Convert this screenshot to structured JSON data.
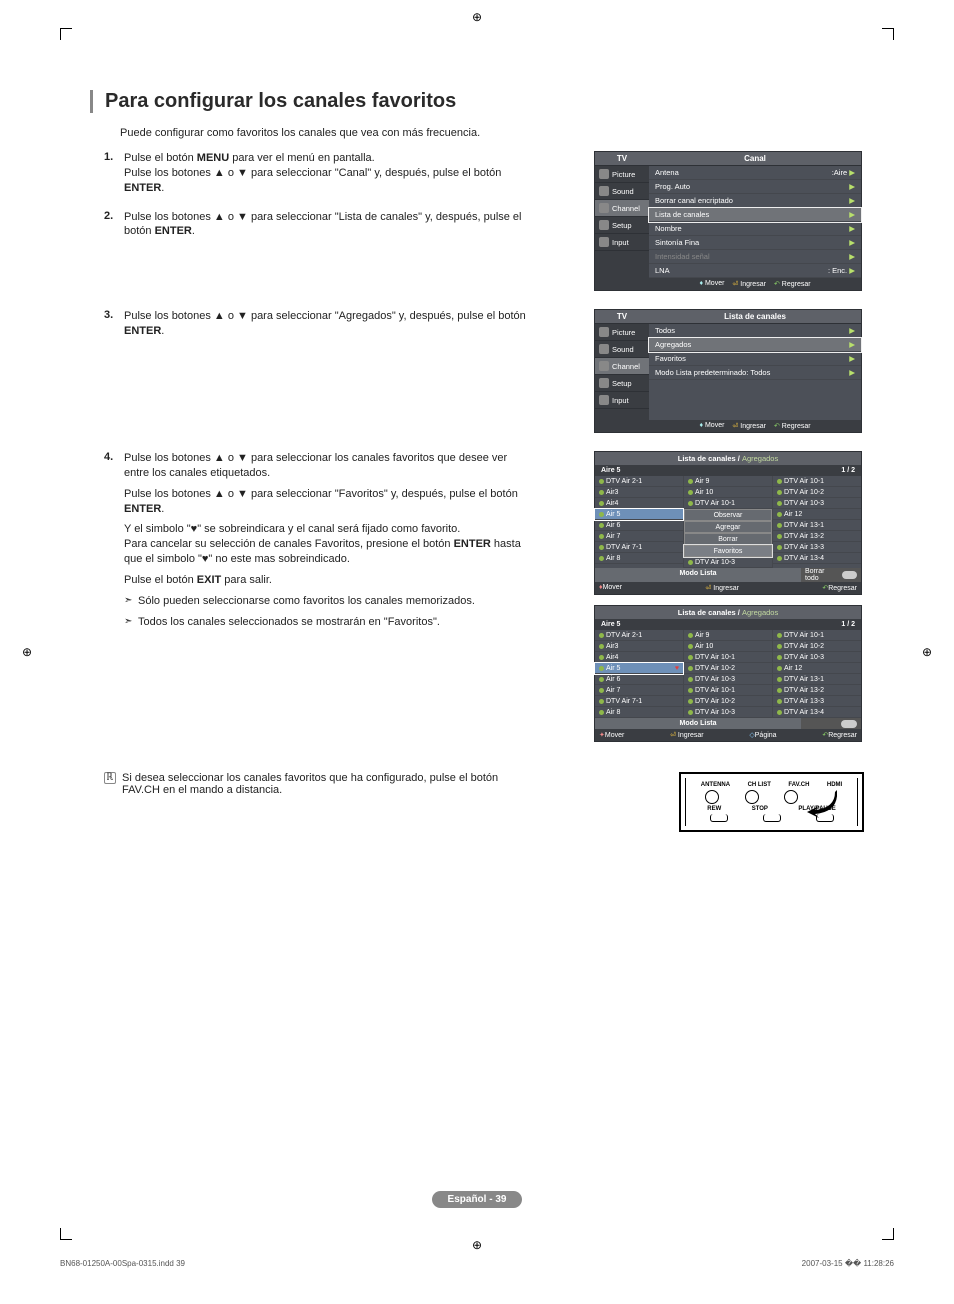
{
  "title": "Para configurar los canales favoritos",
  "intro": "Puede configurar como favoritos los canales que vea con más frecuencia.",
  "steps": {
    "s1": {
      "n": "1.",
      "a": "Pulse el botón ",
      "b": "MENU",
      "c": " para ver el menú en pantalla.",
      "d": "Pulse los botones ▲ o ▼ para seleccionar \"Canal\" y, después, pulse el botón ",
      "e": "ENTER",
      "f": "."
    },
    "s2": {
      "n": "2.",
      "a": "Pulse los botones ▲ o ▼ para seleccionar \"Lista de canales\" y, después, pulse el botón ",
      "b": "ENTER",
      "c": "."
    },
    "s3": {
      "n": "3.",
      "a": "Pulse los botones ▲ o ▼ para seleccionar \"Agregados\" y, después, pulse el botón ",
      "b": "ENTER",
      "c": "."
    },
    "s4": {
      "n": "4.",
      "a": "Pulse los botones ▲ o ▼ para seleccionar los canales favoritos que desee ver entre los canales etiquetados.",
      "b": "Pulse los botones ▲ o ▼ para seleccionar \"Favoritos\" y, después, pulse el botón ",
      "c": "ENTER",
      "d": ".",
      "e1": "Y el simbolo \"♥\" se sobreindicara y el canal será fijado como favorito.",
      "e2": "Para cancelar su selección de canales Favoritos, presione el botón ",
      "e3": "ENTER",
      "e4": " hasta que el simbolo \"♥\" no este mas sobreindicado.",
      "f": "Pulse el botón ",
      "g": "EXIT",
      "h": " para salir.",
      "note1": "Sólo pueden seleccionarse como favoritos los canales memorizados.",
      "note2": "Todos los canales seleccionados se mostrarán en \"Favoritos\"."
    }
  },
  "remote_note": {
    "icon": "ℝ",
    "text": "Si desea seleccionar los canales favoritos que ha configurado, pulse el botón FAV.CH en el mando a distancia."
  },
  "osd1": {
    "tv": "TV",
    "title": "Canal",
    "side": [
      "Picture",
      "Sound",
      "Channel",
      "Setup",
      "Input"
    ],
    "items": [
      {
        "l": "Antena",
        "r": ":Aire"
      },
      {
        "l": "Prog. Auto",
        "r": ""
      },
      {
        "l": "Borrar canal encriptado",
        "r": ""
      },
      {
        "l": "Lista de canales",
        "r": "",
        "hl": true
      },
      {
        "l": "Nombre",
        "r": ""
      },
      {
        "l": "Sintonía Fina",
        "r": ""
      },
      {
        "l": "Intensidad señal",
        "r": "",
        "dim": true
      },
      {
        "l": "LNA",
        "r": ": Enc."
      }
    ],
    "foot": {
      "a": "Mover",
      "b": "Ingresar",
      "c": "Regresar"
    }
  },
  "osd2": {
    "tv": "TV",
    "title": "Lista de canales",
    "side": [
      "Picture",
      "Sound",
      "Channel",
      "Setup",
      "Input"
    ],
    "items": [
      {
        "l": "Todos",
        "r": ""
      },
      {
        "l": "Agregados",
        "r": "",
        "hl": true
      },
      {
        "l": "Favoritos",
        "r": ""
      },
      {
        "l": "Modo Lista predeterminado: Todos",
        "r": ""
      }
    ],
    "foot": {
      "a": "Mover",
      "b": "Ingresar",
      "c": "Regresar"
    }
  },
  "cl1": {
    "title": "Lista de canales / ",
    "sub": "Agregados",
    "head_l": "Aire 5",
    "head_r": "1 / 2",
    "col1": [
      "DTV Air 2-1",
      "Air3",
      "Air4",
      "Air 5",
      "Air 6",
      "Air 7",
      "DTV Air 7-1",
      "Air 8"
    ],
    "col2": [
      "Air 9",
      "Air 10",
      "DTV Air 10-1",
      "Observar",
      "Agregar",
      "Borrar",
      "Favoritos",
      "DTV Air 10-3"
    ],
    "col2_btns": [
      3,
      4,
      5,
      6
    ],
    "col2_hl": 6,
    "col3": [
      "DTV Air 10-1",
      "DTV Air 10-2",
      "DTV Air 10-3",
      "Air 12",
      "DTV Air 13-1",
      "DTV Air 13-2",
      "DTV Air 13-3",
      "DTV Air 13-4"
    ],
    "hl_row": 3,
    "modo": "Modo Lista",
    "borrar": "Borrar todo",
    "foot": {
      "a": "Mover",
      "b": "Ingresar",
      "c": "Regresar"
    }
  },
  "cl2": {
    "title": "Lista de canales / ",
    "sub": "Agregados",
    "head_l": "Aire 5",
    "head_r": "1 / 2",
    "col1": [
      "DTV Air 2-1",
      "Air3",
      "Air4",
      "Air 5",
      "Air 6",
      "Air 7",
      "DTV Air 7-1",
      "Air 8"
    ],
    "col2": [
      "Air 9",
      "Air 10",
      "DTV Air 10-1",
      "DTV Air 10-2",
      "DTV Air 10-3",
      "DTV Air 10-1",
      "DTV Air 10-2",
      "DTV Air 10-3"
    ],
    "col3": [
      "DTV Air 10-1",
      "DTV Air 10-2",
      "DTV Air 10-3",
      "Air 12",
      "DTV Air 13-1",
      "DTV Air 13-2",
      "DTV Air 13-3",
      "DTV Air 13-4"
    ],
    "hl_row": 3,
    "heart_row": 3,
    "modo": "Modo Lista",
    "foot": {
      "a": "Mover",
      "b": "Ingresar",
      "p": "Página",
      "c": "Regresar"
    }
  },
  "remote": {
    "r1": [
      "ANTENNA",
      "CH LIST",
      "FAV.CH",
      "HDMI"
    ],
    "r2": [
      "REW",
      "STOP",
      "PLAY/PAUSE"
    ]
  },
  "footer": "Español - 39",
  "meta": {
    "l": "BN68-01250A-00Spa-0315.indd   39",
    "r": "2007-03-15   �� 11:28:26"
  }
}
